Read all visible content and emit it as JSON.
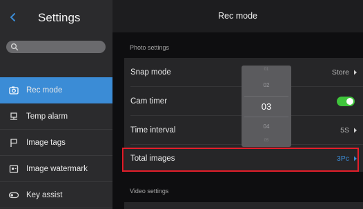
{
  "sidebar": {
    "title": "Settings",
    "search": {
      "placeholder": "",
      "value": ""
    },
    "items": [
      {
        "label": "Rec mode",
        "icon": "camera-icon",
        "active": true
      },
      {
        "label": "Temp alarm",
        "icon": "thermometer-alarm-icon",
        "active": false
      },
      {
        "label": "Image tags",
        "icon": "flag-icon",
        "active": false
      },
      {
        "label": "Image watermark",
        "icon": "watermark-icon",
        "active": false
      },
      {
        "label": "Key assist",
        "icon": "toggle-key-icon",
        "active": false
      }
    ]
  },
  "main": {
    "title": "Rec mode",
    "photo_section": {
      "label": "Photo settings",
      "rows": [
        {
          "label": "Snap mode",
          "value": "Store"
        },
        {
          "label": "Cam timer",
          "toggle": true
        },
        {
          "label": "Time interval",
          "value": "5S"
        },
        {
          "label": "Total images",
          "value": "3Pc"
        }
      ]
    },
    "video_section": {
      "label": "Video settings"
    }
  },
  "picker": {
    "values": [
      "01",
      "02",
      "03",
      "04",
      "05"
    ],
    "selected": "03"
  },
  "colors": {
    "accent": "#3b8cd6",
    "toggle_on": "#3fc43b",
    "highlight": "#e41e2a"
  }
}
